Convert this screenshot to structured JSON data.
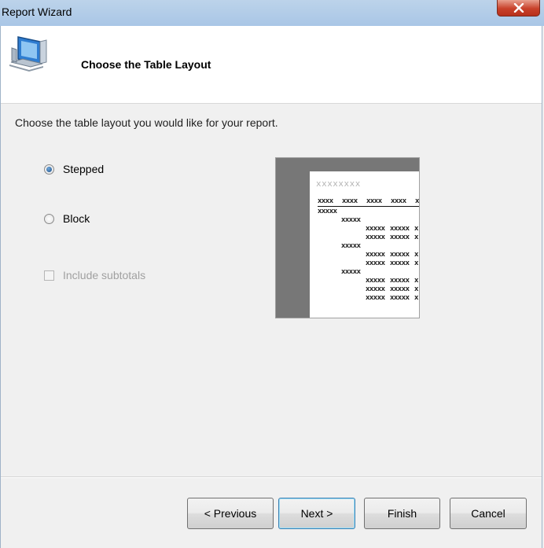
{
  "window": {
    "title": "Report Wizard"
  },
  "header": {
    "title": "Choose the Table Layout",
    "icon": "computer-icon"
  },
  "instructions": "Choose the table layout you would like for your report.",
  "layout_options": {
    "stepped": {
      "label": "Stepped",
      "selected": true
    },
    "block": {
      "label": "Block",
      "selected": false
    }
  },
  "subtotals": {
    "label": "Include subtotals",
    "checked": false,
    "enabled": false
  },
  "preview": {
    "title_placeholder": "xxxxxxxx",
    "header_cells": [
      "xxxx",
      "xxxx",
      "xxxx",
      "xxxx",
      "x"
    ],
    "group_label": "xxxxx",
    "cell_text": "xxxxx"
  },
  "buttons": {
    "previous": "< Previous",
    "next": "Next >",
    "finish": "Finish",
    "cancel": "Cancel"
  },
  "colors": {
    "accent": "#3c7fb1",
    "close": "#c8412a",
    "preview_bg": "#777777"
  }
}
